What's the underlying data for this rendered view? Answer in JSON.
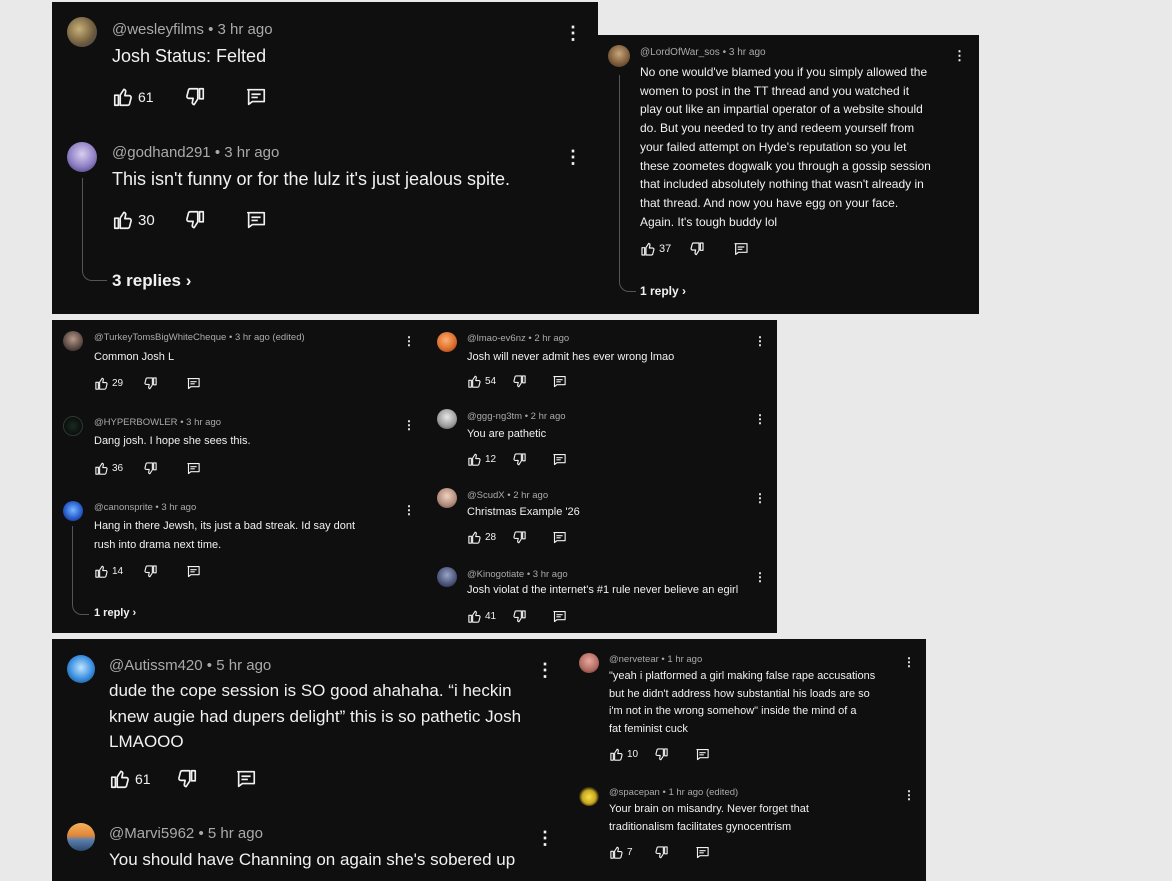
{
  "panel1": {
    "comments": [
      {
        "handle": "@wesleyfilms",
        "time": "3 hr ago",
        "text": "Josh Status: Felted",
        "likes": "61"
      },
      {
        "handle": "@godhand291",
        "time": "3 hr ago",
        "text": "This isn't funny or for the lulz it's just jealous spite.",
        "likes": "30",
        "replies": "3 replies"
      }
    ]
  },
  "panel2": {
    "comments": [
      {
        "handle": "@LordOfWar_sos",
        "time": "3 hr ago",
        "lines": [
          "No one would've blamed you if you simply allowed the",
          "women to post in the TT thread and you watched it",
          "play out like an impartial operator of a website should",
          "do. But you needed to try and redeem yourself from",
          "your failed attempt on Hyde's reputation so you let",
          "these zoometes dogwalk you through a gossip session",
          "that included absolutely nothing that wasn't already in",
          "that thread. And now you have egg on your face.",
          "Again. It's tough buddy lol"
        ],
        "likes": "37",
        "replies": "1 reply"
      }
    ]
  },
  "panel3": {
    "left": [
      {
        "handle": "@TurkeyTomsBigWhiteCheque",
        "time": "3 hr ago (edited)",
        "lines": [
          "Common Josh L"
        ],
        "likes": "29"
      },
      {
        "handle": "@HYPERBOWLER",
        "time": "3 hr ago",
        "lines": [
          "Dang josh. I hope she sees this."
        ],
        "likes": "36"
      },
      {
        "handle": "@canonsprite",
        "time": "3 hr ago",
        "lines": [
          "Hang in there Jewsh, its just a bad streak. Id say dont",
          "rush into drama next time."
        ],
        "likes": "14",
        "replies": "1 reply"
      }
    ],
    "right": [
      {
        "handle": "@lmao-ev6nz",
        "time": "2 hr ago",
        "lines": [
          "Josh will never admit hes ever wrong lmao"
        ],
        "likes": "54"
      },
      {
        "handle": "@ggg-ng3tm",
        "time": "2 hr ago",
        "lines": [
          "You are pathetic"
        ],
        "likes": "12"
      },
      {
        "handle": "@ScudX",
        "time": "2 hr ago",
        "lines": [
          "Christmas Example '26"
        ],
        "likes": "28"
      },
      {
        "handle": "@Kinogotiate",
        "time": "3 hr ago",
        "lines": [
          "Josh violat d the internet's #1 rule never believe an egirl"
        ],
        "likes": "41"
      }
    ]
  },
  "panel4": {
    "left": [
      {
        "handle": "@Autissm420",
        "time": "5 hr ago",
        "lines": [
          "dude the cope session is SO good ahahaha. “i heckin",
          "knew augie had dupers delight” this is so pathetic Josh",
          "LMAOOO"
        ],
        "likes": "61"
      },
      {
        "handle": "@Marvi5962",
        "time": "5 hr ago",
        "lines": [
          "You should have Channing on again she's sobered up"
        ]
      }
    ],
    "right": [
      {
        "handle": "@nervetear",
        "time": "1 hr ago",
        "lines": [
          "\"yeah i platformed a girl making false rape accusations",
          "but he didn't address how substantial his loads are so",
          "i'm not in the wrong somehow\" inside the mind of a",
          "fat feminist cuck"
        ],
        "likes": "10"
      },
      {
        "handle": "@spacepan",
        "time": "1 hr ago (edited)",
        "lines": [
          "Your brain on misandry. Never forget that",
          "traditionalism facilitates gynocentrism"
        ],
        "likes": "7"
      }
    ]
  },
  "separator": "•",
  "icons": {
    "like": "thumbs-up-icon",
    "dislike": "thumbs-down-icon",
    "reply": "comment-icon",
    "more": "more-vert-icon",
    "chevron": "chevron-right-icon"
  },
  "colors": {
    "panel_bg": "#0f0f0f",
    "text": "#f1f1f1",
    "meta": "#aaaaaa",
    "page_bg": "#e9e9e9"
  }
}
